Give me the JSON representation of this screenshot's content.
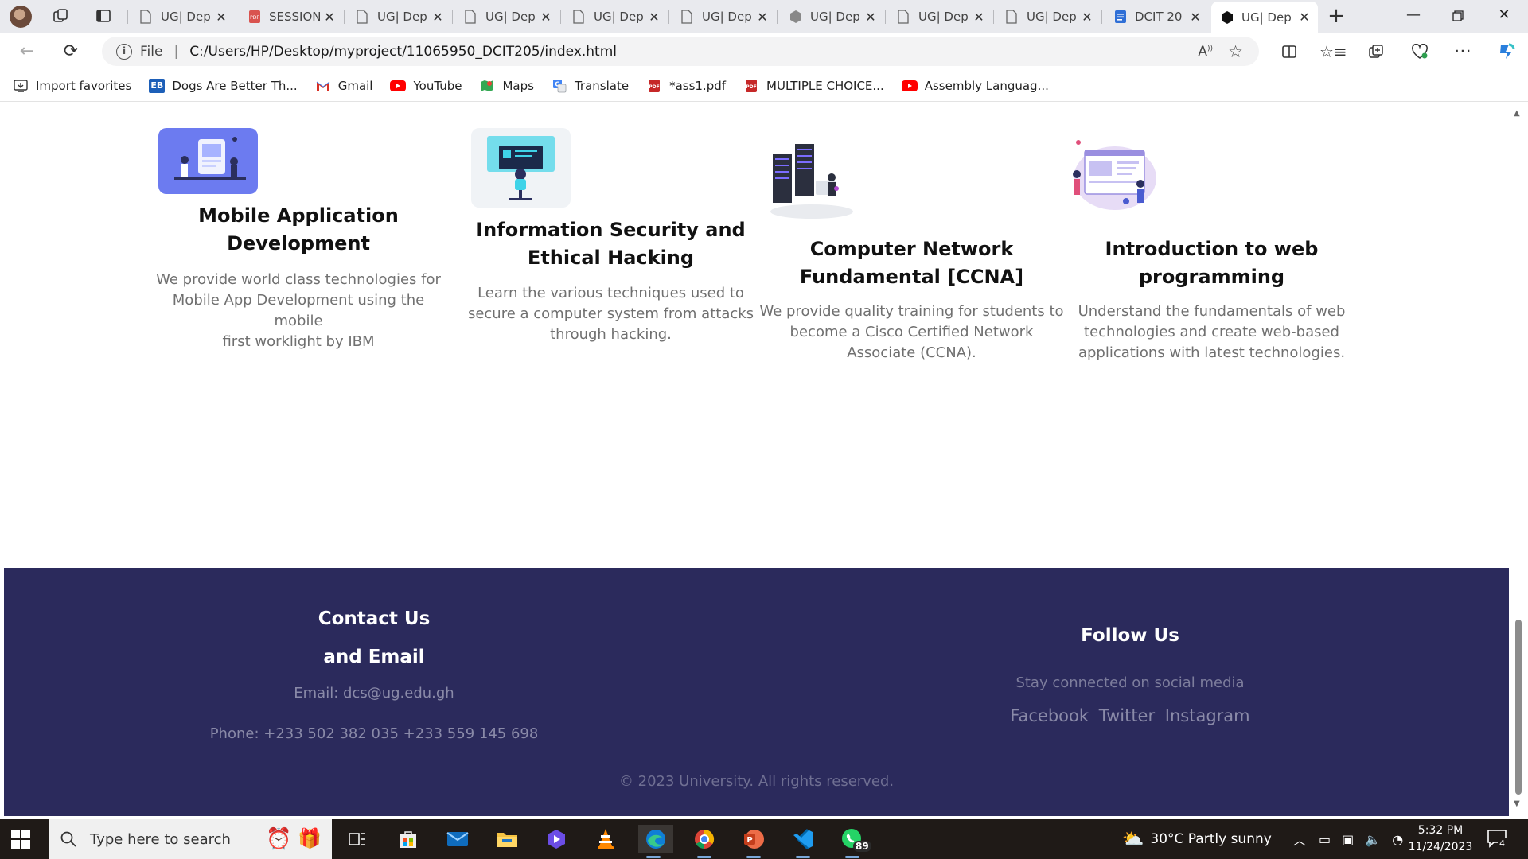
{
  "browser": {
    "tabs": [
      {
        "title": "UG| Dep",
        "icon": "page-icon"
      },
      {
        "title": "SESSION",
        "icon": "pdf-icon"
      },
      {
        "title": "UG| Dep",
        "icon": "page-icon"
      },
      {
        "title": "UG| Dep",
        "icon": "page-icon"
      },
      {
        "title": "UG| Dep",
        "icon": "page-icon"
      },
      {
        "title": "UG| Dep",
        "icon": "page-icon"
      },
      {
        "title": "UG| Dep",
        "icon": "cube-icon"
      },
      {
        "title": "UG| Dep",
        "icon": "page-icon"
      },
      {
        "title": "UG| Dep",
        "icon": "page-icon"
      },
      {
        "title": "DCIT 20",
        "icon": "doc-icon"
      },
      {
        "title": "UG| Dep",
        "icon": "cube-icon"
      }
    ],
    "address": {
      "file_label": "File",
      "url": "C:/Users/HP/Desktop/myproject/11065950_DCIT205/index.html"
    },
    "bookmarks": [
      {
        "label": "Import favorites",
        "icon": "import-icon"
      },
      {
        "label": "Dogs Are Better Th...",
        "icon": "eb-icon"
      },
      {
        "label": "Gmail",
        "icon": "gmail-icon"
      },
      {
        "label": "YouTube",
        "icon": "youtube-icon"
      },
      {
        "label": "Maps",
        "icon": "maps-icon"
      },
      {
        "label": "Translate",
        "icon": "translate-icon"
      },
      {
        "label": "*ass1.pdf",
        "icon": "pdf-icon"
      },
      {
        "label": "MULTIPLE CHOICE...",
        "icon": "pdf-icon"
      },
      {
        "label": "Assembly Languag...",
        "icon": "youtube-icon"
      }
    ]
  },
  "courses": [
    {
      "title_line1": "Mobile Application",
      "title_line2": "Development",
      "desc_line1": "We provide world class technologies for",
      "desc_line2": "Mobile App Development using the mobile",
      "desc_line3": "first worklight by IBM"
    },
    {
      "title_line1": "Information Security and",
      "title_line2": "Ethical Hacking",
      "desc_line1": "Learn the various techniques used to",
      "desc_line2": "secure a computer system from attacks",
      "desc_line3": "through hacking."
    },
    {
      "title_line1": "Computer Network",
      "title_line2": "Fundamental [CCNA]",
      "desc_line1": "We provide quality training for students to",
      "desc_line2": "become a Cisco Certified Network",
      "desc_line3": "Associate (CCNA)."
    },
    {
      "title_line1": "Introduction to web",
      "title_line2": "programming",
      "desc_line1": "Understand the fundamentals of web",
      "desc_line2": "technologies and create web-based",
      "desc_line3": "applications with latest technologies."
    }
  ],
  "footer": {
    "contact_title_line1": "Contact Us",
    "contact_title_line2": "and Email",
    "email": "Email: dcs@ug.edu.gh",
    "phone": "Phone: +233 502 382 035 +233 559 145 698",
    "follow_title": "Follow Us",
    "follow_sub": "Stay connected on social media",
    "social": [
      "Facebook",
      "Twitter",
      "Instagram"
    ],
    "copyright": "© 2023 University. All rights reserved."
  },
  "taskbar": {
    "search_placeholder": "Type here to search",
    "whatsapp_badge": "89",
    "weather": "30°C  Partly sunny",
    "time": "5:32 PM",
    "date": "11/24/2023",
    "notification_count": "4"
  },
  "colors": {
    "footer_bg": "#2b2a5c",
    "footer_muted_text": "#8a8aa8",
    "course_desc_text": "#707070"
  }
}
